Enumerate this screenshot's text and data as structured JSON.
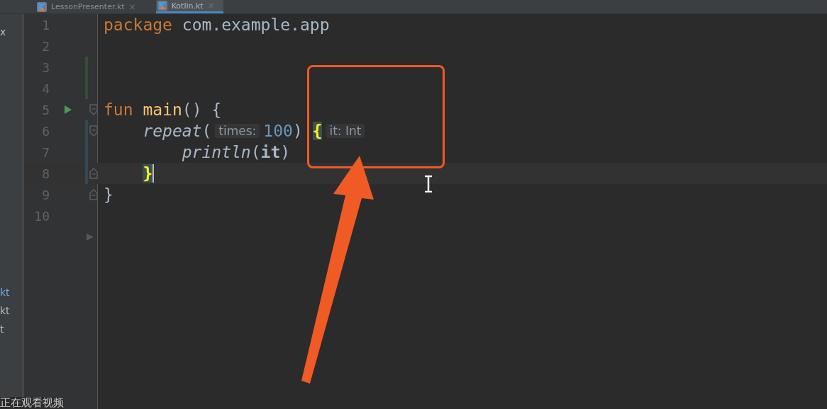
{
  "tabs": [
    {
      "label": "LessonPresenter.kt",
      "close": "×",
      "selected": false
    },
    {
      "label": "Kotlin.kt",
      "close": "×",
      "selected": true
    }
  ],
  "sidebar_items": [
    {
      "label": "x",
      "selected": false
    },
    {
      "label": "kt",
      "selected": true
    },
    {
      "label": "kt",
      "selected": false
    },
    {
      "label": "t",
      "selected": false
    }
  ],
  "lines": [
    {
      "number": "1",
      "current": false,
      "tokens": [
        {
          "kind": "keyword",
          "text": "package"
        },
        {
          "kind": "plain",
          "text": " com.example.app"
        }
      ]
    },
    {
      "number": "2",
      "current": false
    },
    {
      "number": "3",
      "current": false,
      "added": true
    },
    {
      "number": "4",
      "current": false,
      "added": true
    },
    {
      "number": "5",
      "current": false,
      "runnable": true,
      "fold_start": true,
      "tokens": [
        {
          "kind": "keyword",
          "text": "fun"
        },
        {
          "kind": "func",
          "text": " main"
        },
        {
          "kind": "plain",
          "text": "() {"
        }
      ],
      "children": [
        {
          "number": "6",
          "current": false,
          "modified": true,
          "fold_start": true,
          "tokens": [
            {
              "kind": "call",
              "text": "repeat"
            },
            {
              "kind": "plain",
              "text": "("
            },
            {
              "kind": "hint",
              "text": "times:"
            },
            {
              "kind": "number",
              "text": "100"
            },
            {
              "kind": "plain",
              "text": ") "
            },
            {
              "kind": "brace",
              "text": "{"
            },
            {
              "kind": "hint",
              "text": "it: Int"
            }
          ],
          "children": [
            {
              "number": "7",
              "current": false,
              "modified": true,
              "tokens": [
                {
                  "kind": "call",
                  "text": "println"
                },
                {
                  "kind": "plain",
                  "text": "("
                },
                {
                  "kind": "bold",
                  "text": "it"
                },
                {
                  "kind": "plain",
                  "text": ")"
                }
              ]
            }
          ]
        },
        {
          "number": "8",
          "current": true,
          "modified": true,
          "fold_end": true,
          "tokens": [
            {
              "kind": "brace",
              "text": "}"
            }
          ]
        }
      ]
    },
    {
      "number": "9",
      "current": false,
      "fold_end": true,
      "tokens": [
        {
          "kind": "plain",
          "text": "}"
        }
      ]
    },
    {
      "number": "10",
      "current": false
    }
  ],
  "subtitle": "正在观看视频"
}
